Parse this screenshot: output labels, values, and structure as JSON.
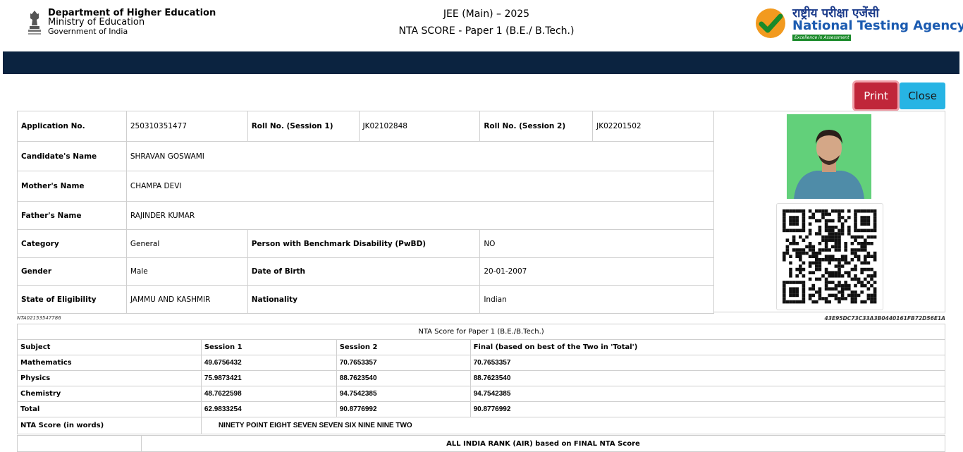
{
  "header": {
    "dept_line1": "Department of Higher Education",
    "dept_line2": "Ministry of Education",
    "dept_line3": "Government of India",
    "title_line1": "JEE (Main) – 2025",
    "title_line2": "NTA SCORE - Paper 1 (B.E./ B.Tech.)",
    "nta_hindi": "राष्ट्रीय परीक्षा एजेंसी",
    "nta_english": "National Testing Agency",
    "nta_tagline": "Excellence in Assessment"
  },
  "actions": {
    "print_label": "Print",
    "close_label": "Close"
  },
  "candidate": {
    "application_no": {
      "label": "Application No.",
      "value": "250310351477"
    },
    "roll_session1": {
      "label": "Roll No. (Session 1)",
      "value": "JK02102848"
    },
    "roll_session2": {
      "label": "Roll No. (Session 2)",
      "value": "JK02201502"
    },
    "name": {
      "label": "Candidate's Name",
      "value": "SHRAVAN GOSWAMI"
    },
    "mother": {
      "label": "Mother's Name",
      "value": "CHAMPA DEVI"
    },
    "father": {
      "label": "Father's Name",
      "value": "RAJINDER KUMAR"
    },
    "category": {
      "label": "Category",
      "value": "General"
    },
    "pwbd": {
      "label": "Person with Benchmark Disability (PwBD)",
      "value": "NO"
    },
    "gender": {
      "label": "Gender",
      "value": "Male"
    },
    "dob": {
      "label": "Date of Birth",
      "value": "20-01-2007"
    },
    "state": {
      "label": "State of Eligibility",
      "value": "JAMMU AND KASHMIR"
    },
    "nationality": {
      "label": "Nationality",
      "value": "Indian"
    }
  },
  "codes": {
    "left": "NTA02153547786",
    "right": "43E95DC73C33A3B0440161FB72D56E1A"
  },
  "score": {
    "title": "NTA Score for Paper 1 (B.E./B.Tech.)",
    "headers": [
      "Subject",
      "Session 1",
      "Session 2",
      "Final (based on best of the Two in 'Total')"
    ],
    "rows": [
      [
        "Mathematics",
        "49.6756432",
        "70.7653357",
        "70.7653357"
      ],
      [
        "Physics",
        "75.9873421",
        "88.7623540",
        "88.7623540"
      ],
      [
        "Chemistry",
        "48.7622598",
        "94.7542385",
        "94.7542385"
      ],
      [
        "Total",
        "62.9833254",
        "90.8776992",
        "90.8776992"
      ]
    ],
    "words_label": "NTA Score (in words)",
    "words_value": "NINETY POINT EIGHT SEVEN SEVEN SIX NINE NINE TWO",
    "air_title": "ALL INDIA RANK (AIR) based on FINAL NTA Score"
  }
}
